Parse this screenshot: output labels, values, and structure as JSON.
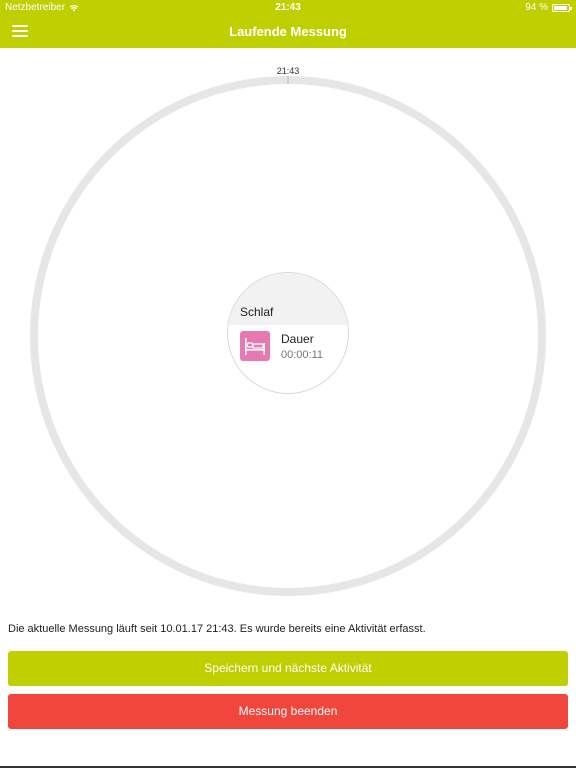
{
  "status_bar": {
    "carrier": "Netzbetreiber",
    "time": "21:43",
    "battery": "94 %",
    "battery_level": 0.94,
    "wifi_icon": "wifi-icon",
    "battery_icon": "battery-icon"
  },
  "nav": {
    "title": "Laufende Messung",
    "menu_icon": "hamburger-menu-icon"
  },
  "clock": {
    "start_label": "21:43"
  },
  "activity": {
    "name": "Schlaf",
    "icon": "bed-icon",
    "icon_color": "#e678b4",
    "duration_label": "Dauer",
    "duration_value": "00:00:11"
  },
  "info_text": "Die aktuelle Messung läuft seit 10.01.17 21:43. Es wurde bereits eine Aktivität erfasst.",
  "buttons": {
    "save_next": "Speichern und nächste Aktivität",
    "end": "Messung beenden"
  },
  "colors": {
    "accent": "#bfcf00",
    "danger": "#f0463c",
    "ring": "#e6e6e6"
  }
}
